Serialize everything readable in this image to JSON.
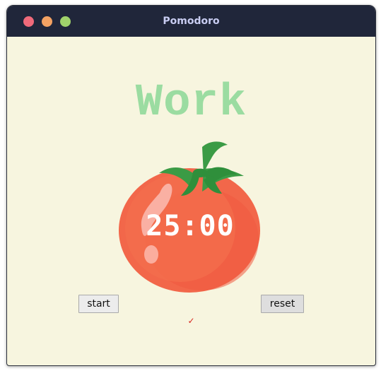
{
  "window": {
    "title": "Pomodoro"
  },
  "main": {
    "mode_label": "Work",
    "timer_text": "25:00",
    "start_label": "start",
    "reset_label": "reset",
    "checkmarks": "✓"
  },
  "colors": {
    "background": "#f7f5df",
    "titlebar": "#20263a",
    "mode_label": "#9bdca1",
    "tomato": "#f2674a",
    "checkmark": "#d7261f"
  },
  "icons": {
    "tomato": "tomato-icon"
  }
}
